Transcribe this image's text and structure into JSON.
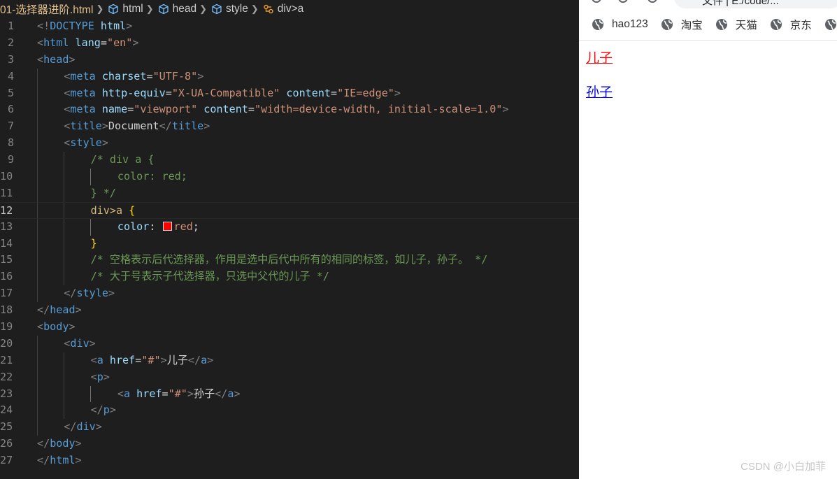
{
  "editor": {
    "breadcrumbs": {
      "file": "01-选择器进阶.html",
      "html": "html",
      "head": "head",
      "style": "style",
      "selector": "div>a"
    },
    "current_line": 12,
    "lines": [
      {
        "n": "1",
        "indent": 0,
        "tokens": [
          [
            "p",
            "<!"
          ],
          [
            "t",
            "DOCTYPE"
          ],
          [
            "w",
            " "
          ],
          [
            "a",
            "html"
          ],
          [
            "p",
            ">"
          ]
        ]
      },
      {
        "n": "2",
        "indent": 0,
        "tokens": [
          [
            "p",
            "<"
          ],
          [
            "t",
            "html"
          ],
          [
            "w",
            " "
          ],
          [
            "a",
            "lang"
          ],
          [
            "w",
            "="
          ],
          [
            "s",
            "\"en\""
          ],
          [
            "p",
            ">"
          ]
        ]
      },
      {
        "n": "3",
        "indent": 0,
        "tokens": [
          [
            "p",
            "<"
          ],
          [
            "t",
            "head"
          ],
          [
            "p",
            ">"
          ]
        ]
      },
      {
        "n": "4",
        "indent": 1,
        "tokens": [
          [
            "p",
            "<"
          ],
          [
            "t",
            "meta"
          ],
          [
            "w",
            " "
          ],
          [
            "a",
            "charset"
          ],
          [
            "w",
            "="
          ],
          [
            "s",
            "\"UTF-8\""
          ],
          [
            "p",
            ">"
          ]
        ]
      },
      {
        "n": "5",
        "indent": 1,
        "tokens": [
          [
            "p",
            "<"
          ],
          [
            "t",
            "meta"
          ],
          [
            "w",
            " "
          ],
          [
            "a",
            "http-equiv"
          ],
          [
            "w",
            "="
          ],
          [
            "s",
            "\"X-UA-Compatible\""
          ],
          [
            "w",
            " "
          ],
          [
            "a",
            "content"
          ],
          [
            "w",
            "="
          ],
          [
            "s",
            "\"IE=edge\""
          ],
          [
            "p",
            ">"
          ]
        ]
      },
      {
        "n": "6",
        "indent": 1,
        "tokens": [
          [
            "p",
            "<"
          ],
          [
            "t",
            "meta"
          ],
          [
            "w",
            " "
          ],
          [
            "a",
            "name"
          ],
          [
            "w",
            "="
          ],
          [
            "s",
            "\"viewport\""
          ],
          [
            "w",
            " "
          ],
          [
            "a",
            "content"
          ],
          [
            "w",
            "="
          ],
          [
            "s",
            "\"width=device-width, initial-scale=1.0\""
          ],
          [
            "p",
            ">"
          ]
        ]
      },
      {
        "n": "7",
        "indent": 1,
        "tokens": [
          [
            "p",
            "<"
          ],
          [
            "t",
            "title"
          ],
          [
            "p",
            ">"
          ],
          [
            "w",
            "Document"
          ],
          [
            "p",
            "</"
          ],
          [
            "t",
            "title"
          ],
          [
            "p",
            ">"
          ]
        ]
      },
      {
        "n": "8",
        "indent": 1,
        "tokens": [
          [
            "p",
            "<"
          ],
          [
            "t",
            "style"
          ],
          [
            "p",
            ">"
          ]
        ]
      },
      {
        "n": "9",
        "indent": 2,
        "tokens": [
          [
            "c",
            "/* div a {"
          ]
        ]
      },
      {
        "n": "10",
        "indent": 3,
        "tokens": [
          [
            "c",
            "color: red;"
          ]
        ]
      },
      {
        "n": "11",
        "indent": 2,
        "tokens": [
          [
            "c",
            "} */"
          ]
        ]
      },
      {
        "n": "12",
        "indent": 2,
        "tokens": [
          [
            "sel",
            "div>a"
          ],
          [
            "w",
            " "
          ],
          [
            "y",
            "{"
          ]
        ]
      },
      {
        "n": "13",
        "indent": 3,
        "tokens": [
          [
            "a",
            "color"
          ],
          [
            "w",
            ": "
          ],
          [
            "swatch",
            ""
          ],
          [
            "s",
            "red"
          ],
          [
            "w",
            ";"
          ]
        ]
      },
      {
        "n": "14",
        "indent": 2,
        "tokens": [
          [
            "y",
            "}"
          ]
        ]
      },
      {
        "n": "15",
        "indent": 2,
        "tokens": [
          [
            "c",
            "/* 空格表示后代选择器，作用是选中后代中所有的相同的标签，如儿子，孙子。 */"
          ]
        ]
      },
      {
        "n": "16",
        "indent": 2,
        "tokens": [
          [
            "c",
            "/* 大于号表示子代选择器，只选中父代的儿子 */"
          ]
        ]
      },
      {
        "n": "17",
        "indent": 1,
        "tokens": [
          [
            "p",
            "</"
          ],
          [
            "t",
            "style"
          ],
          [
            "p",
            ">"
          ]
        ]
      },
      {
        "n": "18",
        "indent": 0,
        "tokens": [
          [
            "p",
            "</"
          ],
          [
            "t",
            "head"
          ],
          [
            "p",
            ">"
          ]
        ]
      },
      {
        "n": "19",
        "indent": 0,
        "tokens": [
          [
            "p",
            "<"
          ],
          [
            "t",
            "body"
          ],
          [
            "p",
            ">"
          ]
        ]
      },
      {
        "n": "20",
        "indent": 1,
        "tokens": [
          [
            "p",
            "<"
          ],
          [
            "t",
            "div"
          ],
          [
            "p",
            ">"
          ]
        ]
      },
      {
        "n": "21",
        "indent": 2,
        "tokens": [
          [
            "p",
            "<"
          ],
          [
            "t",
            "a"
          ],
          [
            "w",
            " "
          ],
          [
            "a",
            "href"
          ],
          [
            "w",
            "="
          ],
          [
            "s",
            "\"#\""
          ],
          [
            "p",
            ">"
          ],
          [
            "w",
            "儿子"
          ],
          [
            "p",
            "</"
          ],
          [
            "t",
            "a"
          ],
          [
            "p",
            ">"
          ]
        ]
      },
      {
        "n": "22",
        "indent": 2,
        "tokens": [
          [
            "p",
            "<"
          ],
          [
            "t",
            "p"
          ],
          [
            "p",
            ">"
          ]
        ]
      },
      {
        "n": "23",
        "indent": 3,
        "tokens": [
          [
            "p",
            "<"
          ],
          [
            "t",
            "a"
          ],
          [
            "w",
            " "
          ],
          [
            "a",
            "href"
          ],
          [
            "w",
            "="
          ],
          [
            "s",
            "\"#\""
          ],
          [
            "p",
            ">"
          ],
          [
            "w",
            "孙子"
          ],
          [
            "p",
            "</"
          ],
          [
            "t",
            "a"
          ],
          [
            "p",
            ">"
          ]
        ]
      },
      {
        "n": "24",
        "indent": 2,
        "tokens": [
          [
            "p",
            "</"
          ],
          [
            "t",
            "p"
          ],
          [
            "p",
            ">"
          ]
        ]
      },
      {
        "n": "25",
        "indent": 1,
        "tokens": [
          [
            "p",
            "</"
          ],
          [
            "t",
            "div"
          ],
          [
            "p",
            ">"
          ]
        ]
      },
      {
        "n": "26",
        "indent": 0,
        "tokens": [
          [
            "p",
            "</"
          ],
          [
            "t",
            "body"
          ],
          [
            "p",
            ">"
          ]
        ]
      },
      {
        "n": "27",
        "indent": 0,
        "tokens": [
          [
            "p",
            "</"
          ],
          [
            "t",
            "html"
          ],
          [
            "p",
            ">"
          ]
        ]
      }
    ]
  },
  "browser": {
    "address_fragment": "文件 | E:/code/...",
    "bookmarks": [
      {
        "label": "hao123",
        "icon": "globe-icon"
      },
      {
        "label": "淘宝",
        "icon": "globe-icon"
      },
      {
        "label": "天猫",
        "icon": "globe-icon"
      },
      {
        "label": "京东",
        "icon": "globe-icon"
      }
    ],
    "page": {
      "son_link": "儿子",
      "son_color": "#ff0000",
      "grandson_link": "孙子",
      "grandson_color": "#0000ee"
    }
  },
  "watermark": "CSDN @小白加菲"
}
